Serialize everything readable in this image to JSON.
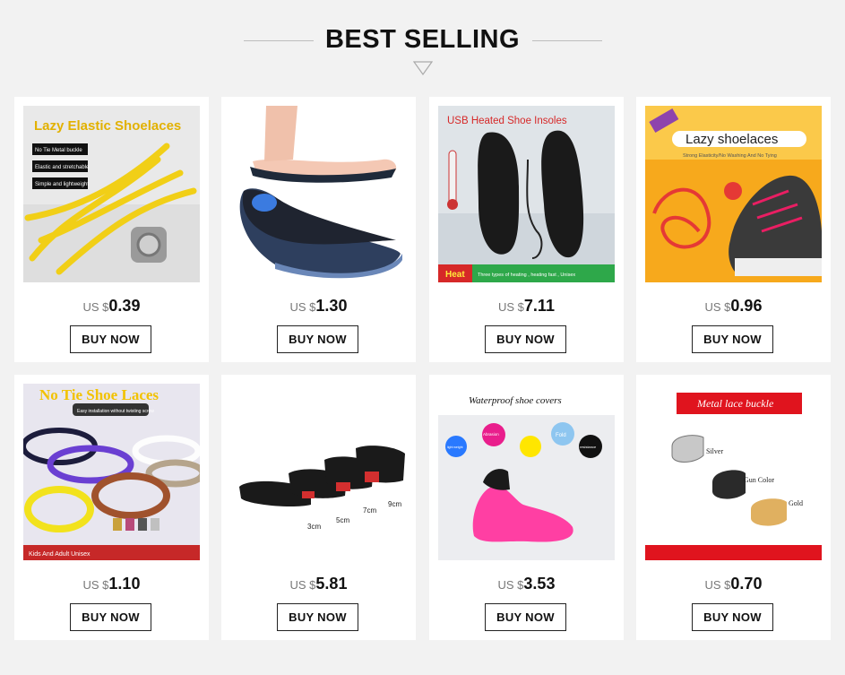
{
  "header": {
    "title": "BEST SELLING"
  },
  "products": [
    {
      "image_text": [
        "Lazy Elastic Shoelaces",
        "No Tie Metal buckle",
        "Elastic and stretchable",
        "Simple and lightweight"
      ],
      "currency": "US $",
      "price": "0.39",
      "button": "BUY NOW"
    },
    {
      "image_text": [],
      "currency": "US $",
      "price": "1.30",
      "button": "BUY NOW"
    },
    {
      "image_text": [
        "USB Heated Shoe Insoles",
        "Heat",
        "Three types of heating , heating fast , Unisex"
      ],
      "currency": "US $",
      "price": "7.11",
      "button": "BUY NOW"
    },
    {
      "image_text": [
        "Lazy shoelaces",
        "Strong Elasticity/No Washing And No Tying"
      ],
      "currency": "US $",
      "price": "0.96",
      "button": "BUY NOW"
    },
    {
      "image_text": [
        "No Tie Shoe Laces",
        "Easy installation without twisting screw",
        "Kids And Adult Unisex"
      ],
      "currency": "US $",
      "price": "1.10",
      "button": "BUY NOW"
    },
    {
      "image_text": [
        "3cm",
        "5cm",
        "7cm",
        "9cm"
      ],
      "currency": "US $",
      "price": "5.81",
      "button": "BUY NOW"
    },
    {
      "image_text": [
        "Waterproof shoe covers",
        "Abrasion",
        "Fold",
        "light weight",
        "resistance"
      ],
      "currency": "US $",
      "price": "3.53",
      "button": "BUY NOW"
    },
    {
      "image_text": [
        "Metal lace buckle",
        "Silver",
        "Gun Color",
        "Gold"
      ],
      "currency": "US $",
      "price": "0.70",
      "button": "BUY NOW"
    }
  ]
}
